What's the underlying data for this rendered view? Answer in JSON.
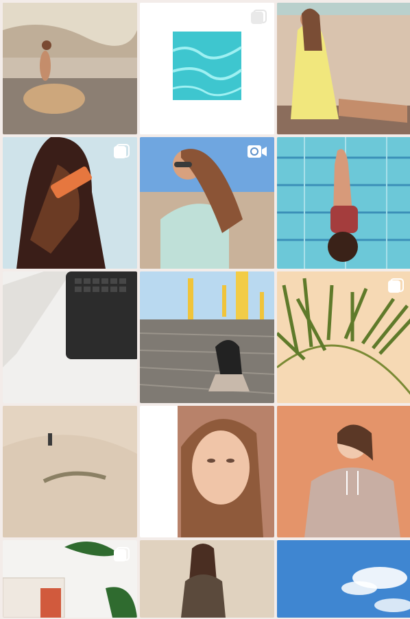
{
  "feed": {
    "rows": [
      [
        {
          "id": "post-rocky-beach",
          "badge": "none"
        },
        {
          "id": "post-pool-square",
          "badge": "carousel"
        },
        {
          "id": "post-beach-yellow",
          "badge": "none"
        }
      ],
      [
        {
          "id": "post-phone-illustration",
          "badge": "carousel"
        },
        {
          "id": "post-sunglasses-portrait",
          "badge": "video"
        },
        {
          "id": "post-pool-float",
          "badge": "none"
        }
      ],
      [
        {
          "id": "post-laptop-desk",
          "badge": "none"
        },
        {
          "id": "post-pier-umbrellas",
          "badge": "none"
        },
        {
          "id": "post-palm-leaf",
          "badge": "carousel"
        }
      ],
      [
        {
          "id": "post-desert-dunes",
          "badge": "none"
        },
        {
          "id": "post-face-closeup",
          "badge": "none"
        },
        {
          "id": "post-hoodie-orange",
          "badge": "none"
        }
      ],
      [
        {
          "id": "post-magazine-plant",
          "badge": "carousel"
        },
        {
          "id": "post-sand-sitting",
          "badge": "none"
        },
        {
          "id": "post-blue-sky",
          "badge": "none"
        }
      ]
    ],
    "colors": {
      "background": "#f3ece9",
      "badge": "#ffffff"
    }
  }
}
